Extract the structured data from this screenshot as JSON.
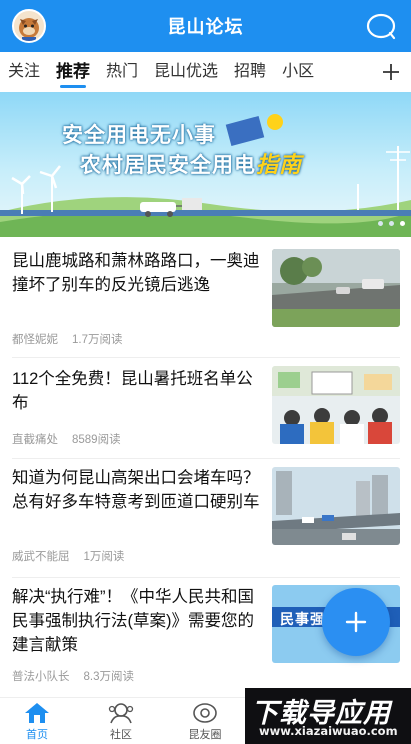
{
  "header": {
    "title": "昆山论坛"
  },
  "tabs": [
    {
      "label": "关注",
      "active": false
    },
    {
      "label": "推荐",
      "active": true
    },
    {
      "label": "热门",
      "active": false
    },
    {
      "label": "昆山优选",
      "active": false
    },
    {
      "label": "招聘",
      "active": false
    },
    {
      "label": "小区",
      "active": false
    }
  ],
  "banner": {
    "line1": "安全用电无小事",
    "line2_main": "农村居民安全用电",
    "line2_highlight": "指南"
  },
  "feed": [
    {
      "title": "昆山鹿城路和萧林路路口，一奥迪撞坏了别车的反光镜后逃逸",
      "author": "都怪妮妮",
      "reads": "1.7万阅读"
    },
    {
      "title": "112个全免费！昆山暑托班名单公布",
      "author": "直截痛处",
      "reads": "8589阅读"
    },
    {
      "title": "知道为何昆山高架出口会堵车吗？总有好多车特意考到匝道口硬别车",
      "author": "威武不能屈",
      "reads": "1万阅读"
    },
    {
      "title": "解决“执行难”！《中华人民共和国民事强制执行法(草案)》需要您的建言献策",
      "author": "普法小队长",
      "reads": "8.3万阅读",
      "thumb_text": "民事强"
    }
  ],
  "bottom_nav": [
    {
      "label": "首页",
      "active": true
    },
    {
      "label": "社区",
      "active": false
    },
    {
      "label": "昆友圈",
      "active": false
    }
  ],
  "watermark": {
    "text": "下载导应用",
    "url": "www.xiazaiwuao.com"
  },
  "colors": {
    "brand": "#1e8ff0",
    "fab": "#2b8ff2"
  }
}
